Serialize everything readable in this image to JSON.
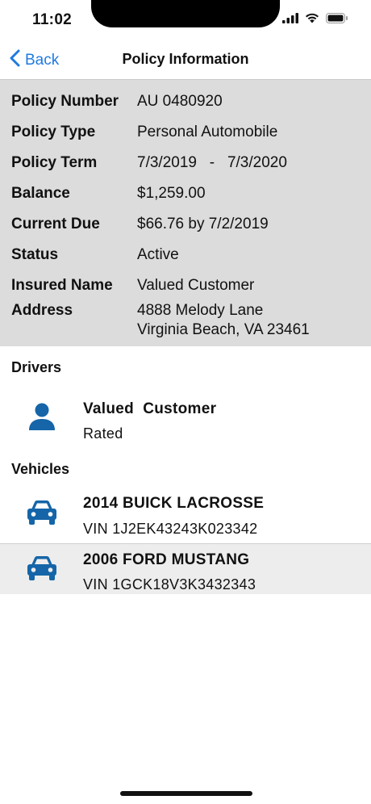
{
  "status_bar": {
    "time": "11:02"
  },
  "nav": {
    "back_label": "Back",
    "title": "Policy Information"
  },
  "policy": {
    "rows": [
      {
        "label": "Policy Number",
        "value": "AU 0480920"
      },
      {
        "label": "Policy Type",
        "value": "Personal Automobile"
      },
      {
        "label": "Policy Term",
        "value": "7/3/2019   -   7/3/2020"
      },
      {
        "label": "Balance",
        "value": "$1,259.00"
      },
      {
        "label": "Current Due",
        "value": "$66.76 by 7/2/2019"
      },
      {
        "label": "Status",
        "value": "Active"
      },
      {
        "label": "Insured Name",
        "value": "Valued Customer"
      },
      {
        "label": "Address",
        "value": "4888 Melody Lane",
        "value_line2": "Virginia Beach, VA 23461"
      }
    ]
  },
  "drivers": {
    "header": "Drivers",
    "items": [
      {
        "name": "Valued  Customer",
        "status": "Rated"
      }
    ]
  },
  "vehicles": {
    "header": "Vehicles",
    "items": [
      {
        "title": "2014 BUICK LACROSSE",
        "vin": "VIN 1J2EK43243K023342"
      },
      {
        "title": "2006 FORD MUSTANG",
        "vin": "VIN 1GCK18V3K3432343"
      }
    ]
  },
  "colors": {
    "accent": "#1f7ae0",
    "icon": "#1565a8",
    "info_bg": "#dcdcdc"
  }
}
